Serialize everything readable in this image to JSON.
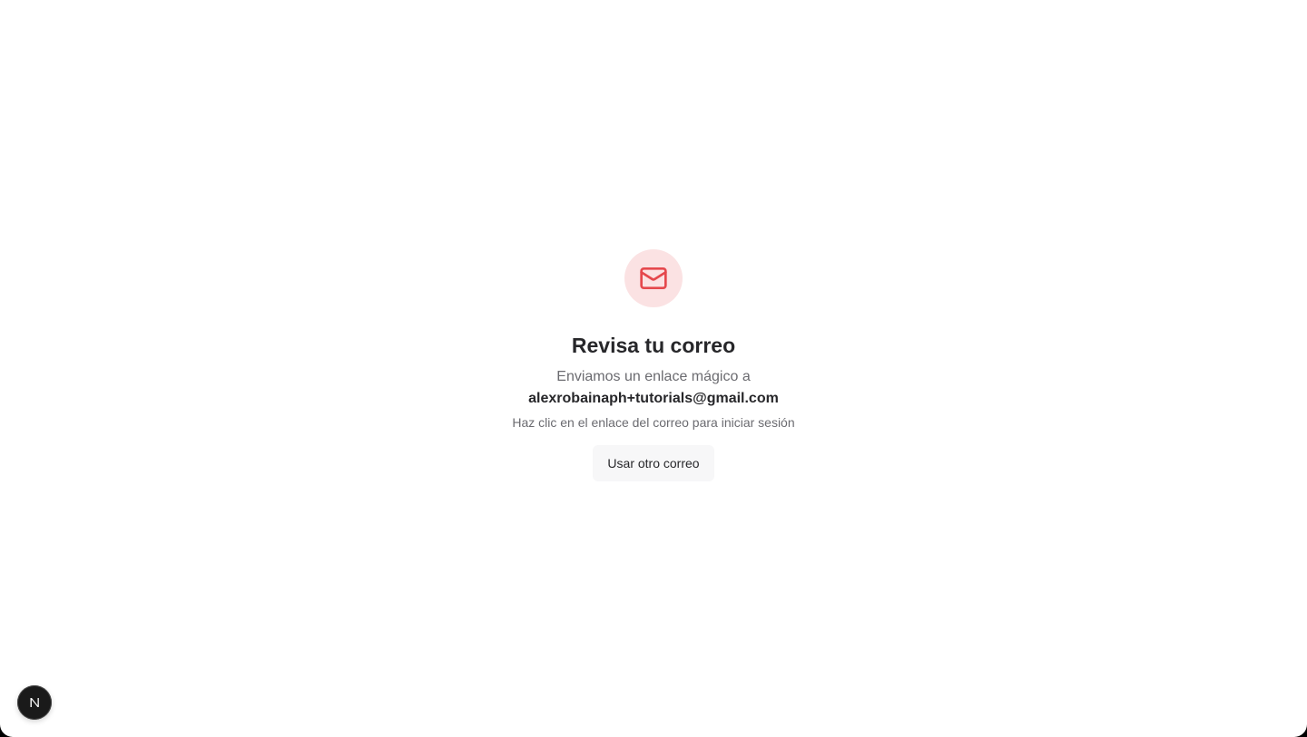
{
  "icons": {
    "main": "mail-icon",
    "badge": "nextjs-logo-icon"
  },
  "colors": {
    "icon_accent": "#e5484d",
    "icon_background": "#fbe2e3"
  },
  "content": {
    "title": "Revisa tu correo",
    "subtitle": "Enviamos un enlace mágico a",
    "email": "alexrobainaph+tutorials@gmail.com",
    "hint": "Haz clic en el enlace del correo para iniciar sesión",
    "button_label": "Usar otro correo"
  }
}
